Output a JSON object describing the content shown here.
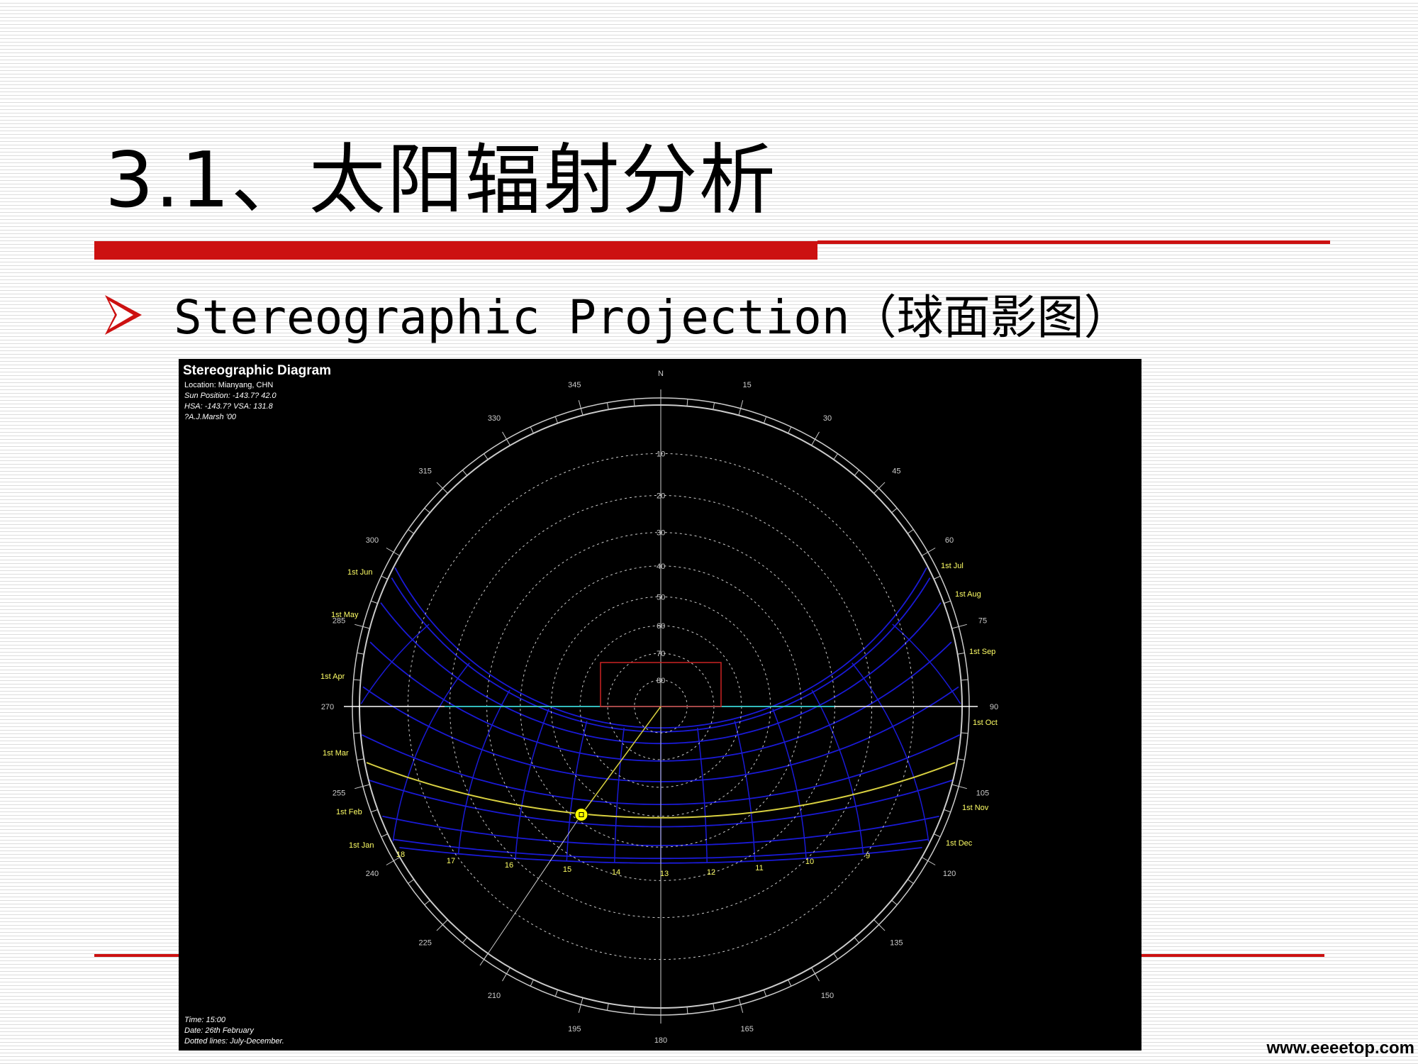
{
  "slide": {
    "title": "3.1、太阳辐射分析",
    "subtitle": "Stereographic Projection（球面影图）",
    "watermark": "www.eeeetop.com"
  },
  "diagram": {
    "heading": "Stereographic Diagram",
    "info_lines": [
      "Location: Mianyang, CHN",
      "Sun Position: -143.7? 42.0",
      "HSA: -143.7? VSA: 131.8",
      "?A.J.Marsh '00"
    ],
    "footer_lines": [
      "Time: 15:00",
      "Date: 26th February",
      "Dotted lines: July-December."
    ],
    "north_label": "N",
    "azimuth_labels": [
      {
        "az": 0,
        "text": "N"
      },
      {
        "az": 15,
        "text": "15"
      },
      {
        "az": 30,
        "text": "30"
      },
      {
        "az": 45,
        "text": "45"
      },
      {
        "az": 60,
        "text": "60"
      },
      {
        "az": 75,
        "text": "75"
      },
      {
        "az": 90,
        "text": "90"
      },
      {
        "az": 105,
        "text": "105"
      },
      {
        "az": 120,
        "text": "120"
      },
      {
        "az": 135,
        "text": "135"
      },
      {
        "az": 150,
        "text": "150"
      },
      {
        "az": 165,
        "text": "165"
      },
      {
        "az": 180,
        "text": "180"
      },
      {
        "az": 195,
        "text": "195"
      },
      {
        "az": 210,
        "text": "210"
      },
      {
        "az": 225,
        "text": "225"
      },
      {
        "az": 240,
        "text": "240"
      },
      {
        "az": 255,
        "text": "255"
      },
      {
        "az": 270,
        "text": "270"
      },
      {
        "az": 285,
        "text": "285"
      },
      {
        "az": 300,
        "text": "300"
      },
      {
        "az": 315,
        "text": "315"
      },
      {
        "az": 330,
        "text": "330"
      },
      {
        "az": 345,
        "text": "345"
      }
    ],
    "altitude_labels": [
      "10",
      "20",
      "30",
      "40",
      "50",
      "60",
      "70",
      "80"
    ],
    "altitudes": [
      10,
      20,
      30,
      40,
      50,
      60,
      70,
      80
    ],
    "month_labels_left": [
      "1st Jun",
      "1st May",
      "1st Apr",
      "1st Mar",
      "1st Feb",
      "1st Jan"
    ],
    "month_labels_right": [
      "1st Jul",
      "1st Aug",
      "1st Sep",
      "1st Oct",
      "1st Nov",
      "1st Dec"
    ],
    "hour_labels": [
      "18",
      "17",
      "16",
      "15",
      "14",
      "13",
      "12",
      "11",
      "10",
      "9"
    ],
    "sun_position": {
      "azimuth": -143.7,
      "altitude": 42.0
    },
    "colors": {
      "background": "#000000",
      "grid": "#cccccc",
      "sun_path": "#1a1ad6",
      "current_path": "#d8d040",
      "horizon": "#ffffff",
      "horizon_highlight": "#33bbbb",
      "marker": "#ffff00",
      "obstruction": "#cc2222",
      "labels": "#ffff66"
    }
  }
}
